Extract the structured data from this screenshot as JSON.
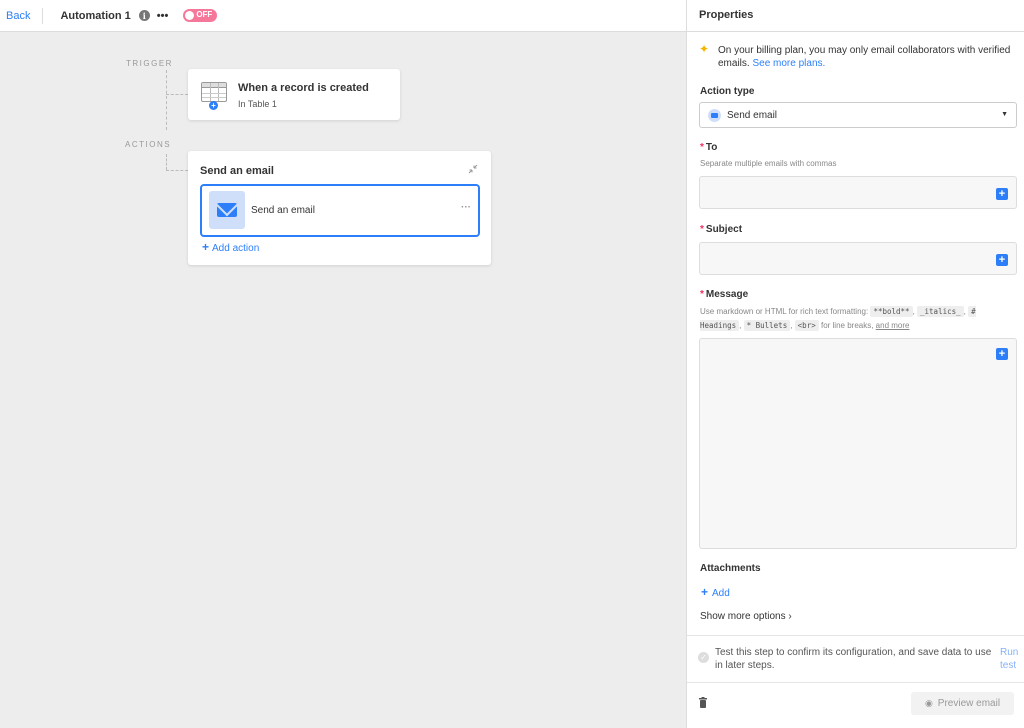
{
  "topbar": {
    "back_label": "Back",
    "automation_name": "Automation 1",
    "info_icon": "info-icon",
    "more_icon": "•••",
    "toggle_state": "OFF",
    "toggle_color": "#f5789a"
  },
  "canvas": {
    "trigger_label": "TRIGGER",
    "actions_label": "ACTIONS",
    "trigger": {
      "title": "When a record is created",
      "subtitle": "In Table 1",
      "icon": "table-icon"
    },
    "action_group": {
      "title": "Send an email",
      "step_label": "Send an email",
      "step_more": "···",
      "add_action_label": "Add action"
    }
  },
  "panel": {
    "title": "Properties",
    "notice": {
      "text": "On your billing plan, you may only email collaborators with verified emails.",
      "link": "See more plans."
    },
    "action_type": {
      "label": "Action type",
      "value": "Send email"
    },
    "to": {
      "label": "To",
      "hint": "Separate multiple emails with commas"
    },
    "subject": {
      "label": "Subject"
    },
    "message": {
      "label": "Message",
      "hint_prefix": "Use markdown or HTML for rich text formatting:",
      "code_bold": "**bold**",
      "code_italics": "_italics_",
      "code_headings": "# Headings",
      "code_bullets": "* Bullets",
      "code_br": "<br>",
      "hint_mid": "for line breaks,",
      "hint_link": "and more"
    },
    "attachments": {
      "label": "Attachments",
      "add_label": "Add"
    },
    "show_more_label": "Show more options",
    "test": {
      "text": "Test this step to confirm its configuration, and save data to use in later steps.",
      "run_label": "Run test"
    },
    "preview_label": "Preview email"
  },
  "colors": {
    "accent": "#2d7ff9",
    "required": "#ef3061"
  }
}
